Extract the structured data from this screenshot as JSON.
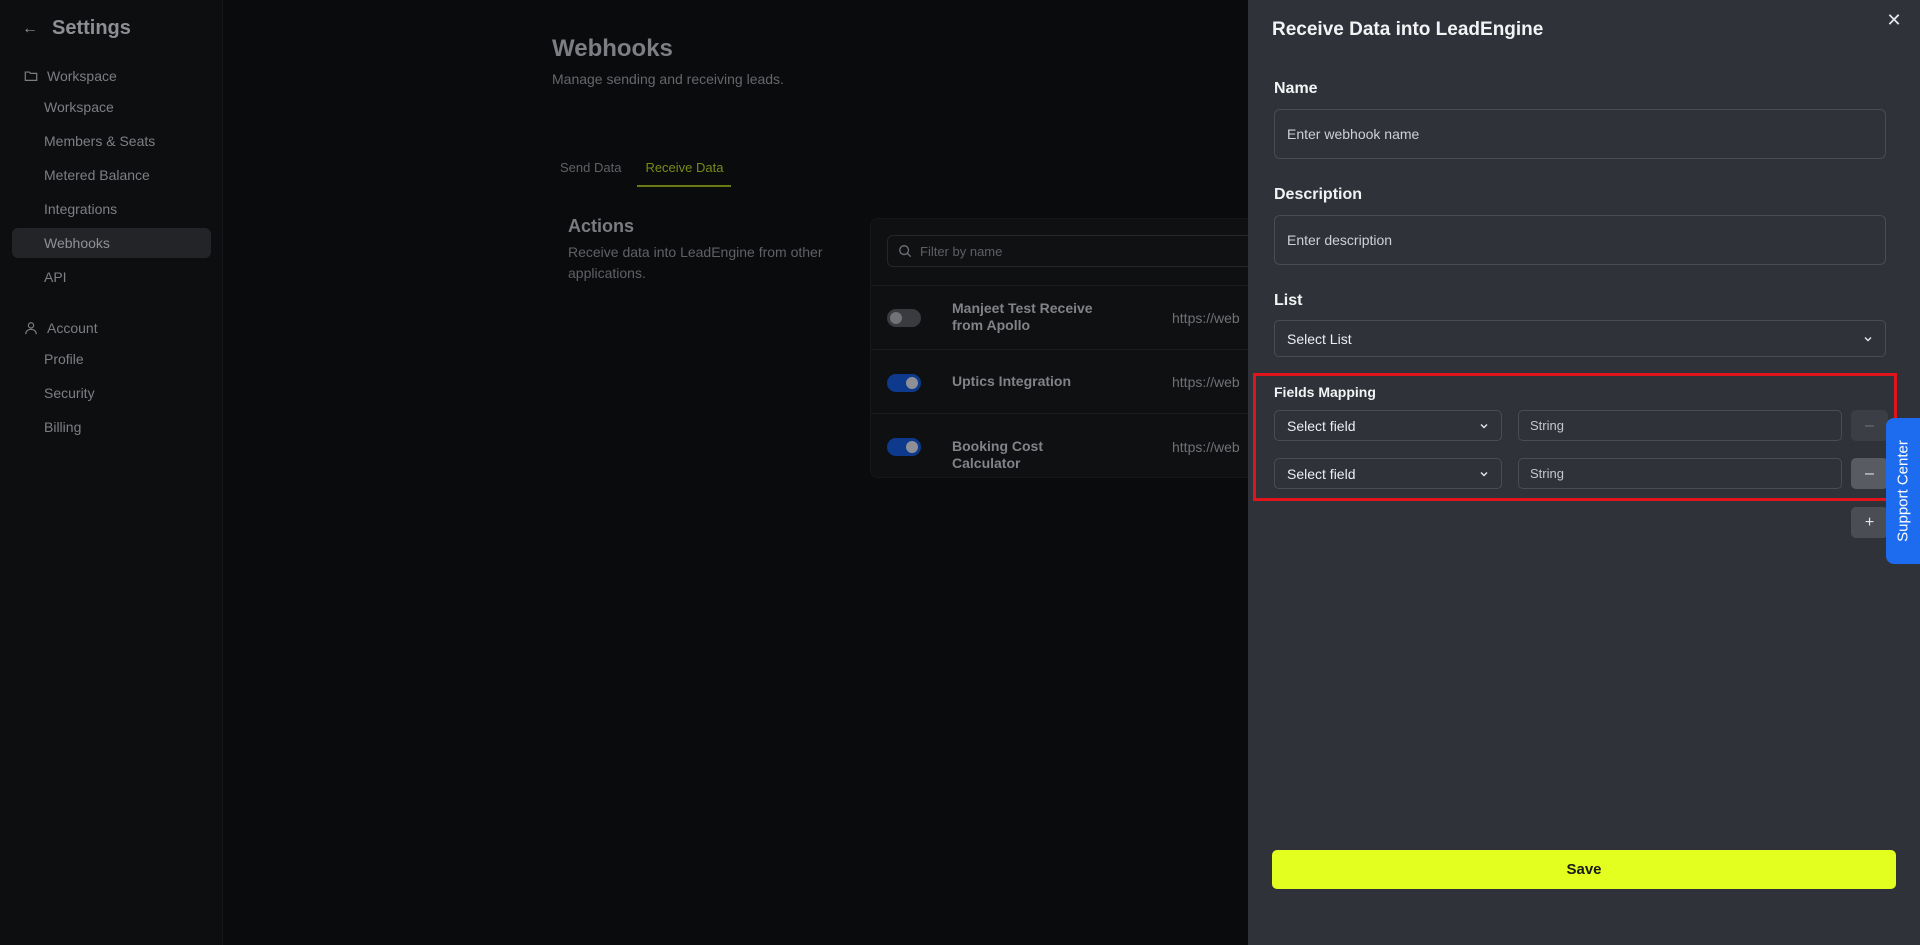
{
  "sidebar": {
    "title": "Settings",
    "workspace_section": "Workspace",
    "workspace_items": [
      "Workspace",
      "Members & Seats",
      "Metered Balance",
      "Integrations",
      "Webhooks",
      "API"
    ],
    "active_item": "Webhooks",
    "account_section": "Account",
    "account_items": [
      "Profile",
      "Security",
      "Billing"
    ]
  },
  "main": {
    "title": "Webhooks",
    "subtitle": "Manage sending and receiving leads.",
    "tabs": [
      "Send Data",
      "Receive Data"
    ],
    "active_tab": "Receive Data",
    "actions_title": "Actions",
    "actions_desc": "Receive data into LeadEngine from other applications.",
    "filter_placeholder": "Filter by name",
    "rows": [
      {
        "name": "Manjeet Test Receive from Apollo",
        "url": "https://web",
        "enabled": false
      },
      {
        "name": "Uptics Integration",
        "url": "https://web",
        "enabled": true
      },
      {
        "name": "Booking Cost Calculator",
        "url": "https://web",
        "enabled": true
      }
    ]
  },
  "drawer": {
    "title": "Receive Data into LeadEngine",
    "name_label": "Name",
    "name_placeholder": "Enter webhook name",
    "description_label": "Description",
    "description_placeholder": "Enter description",
    "list_label": "List",
    "list_value": "Select List",
    "fields_mapping_label": "Fields Mapping",
    "mappings": [
      {
        "field": "Select field",
        "type_placeholder": "String"
      },
      {
        "field": "Select field",
        "type_placeholder": "String"
      }
    ],
    "minus_label": "–",
    "plus_label": "+",
    "save_label": "Save"
  },
  "support_label": "Support Center",
  "colors": {
    "accent": "#e2ff1f",
    "highlight": "#e0141b",
    "support": "#1d6cf0",
    "toggle_on": "#0d3a8c"
  }
}
